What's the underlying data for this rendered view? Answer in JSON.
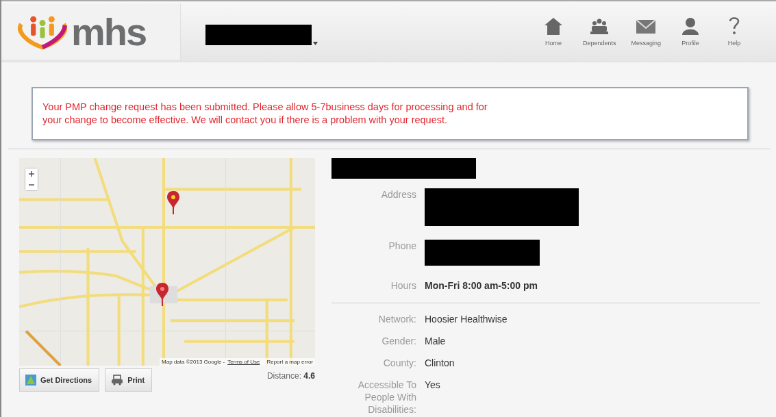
{
  "header": {
    "logo_text": "mhs",
    "nav": [
      {
        "label": "Home",
        "kind": "home"
      },
      {
        "label": "Dependents",
        "kind": "dependents"
      },
      {
        "label": "Messaging",
        "kind": "messaging"
      },
      {
        "label": "Profile",
        "kind": "profile"
      },
      {
        "label": "Help",
        "kind": "help"
      }
    ]
  },
  "alert": {
    "lines": [
      "Your PMP change request has been submitted.   Please allow 5-7business days for processing and for",
      "your change to become effective.  We will contact you if there is a problem with your request."
    ]
  },
  "map": {
    "attribution": "Map data ©2013 Google -",
    "terms_link": "Terms of Use",
    "report_link": "Report a map error"
  },
  "actions": [
    {
      "label": "Get Directions",
      "kind": "directions"
    },
    {
      "label": "Print",
      "kind": "print"
    }
  ],
  "distance": {
    "label": "Distance:",
    "value": "4.6"
  },
  "primary_fields": [
    {
      "label": "Address",
      "redacted": true
    },
    {
      "label": "Phone",
      "redacted": true
    },
    {
      "label": "Hours",
      "redacted": false,
      "value": "Mon-Fri 8:00 am-5:00 pm"
    }
  ],
  "fields": [
    {
      "label": "Network:",
      "value": "Hoosier Healthwise"
    },
    {
      "label": "Gender:",
      "value": "Male"
    },
    {
      "label": "County:",
      "value": "Clinton"
    },
    {
      "label": "Accessible To People With Disabilities:",
      "value": "Yes"
    }
  ]
}
